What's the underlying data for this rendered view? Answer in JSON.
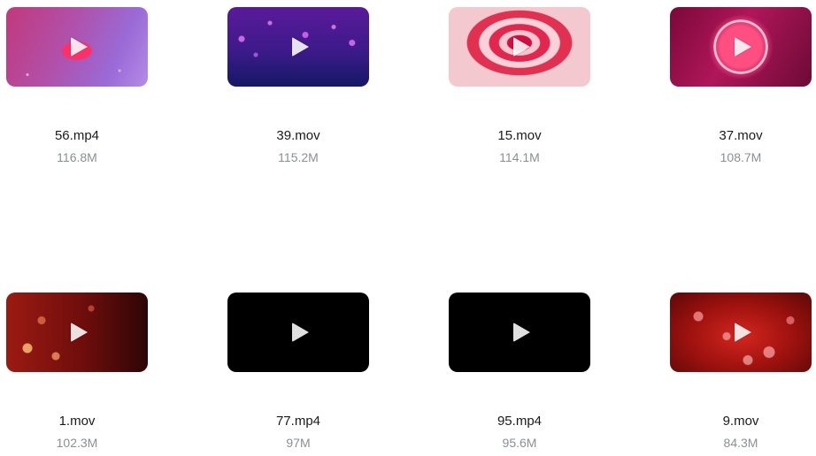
{
  "files": [
    {
      "name": "56.mp4",
      "size": "116.8M",
      "thumb_icon": "play-icon",
      "thumb_style": "heart-violet"
    },
    {
      "name": "39.mov",
      "size": "115.2M",
      "thumb_icon": "play-icon",
      "thumb_style": "bokeh-purple"
    },
    {
      "name": "15.mov",
      "size": "114.1M",
      "thumb_icon": "play-icon",
      "thumb_style": "heart-rings"
    },
    {
      "name": "37.mov",
      "size": "108.7M",
      "thumb_icon": "play-icon",
      "thumb_style": "heart-bubble"
    },
    {
      "name": "1.mov",
      "size": "102.3M",
      "thumb_icon": "play-icon",
      "thumb_style": "hearts-red"
    },
    {
      "name": "77.mp4",
      "size": "97M",
      "thumb_icon": "play-icon",
      "thumb_style": "black"
    },
    {
      "name": "95.mp4",
      "size": "95.6M",
      "thumb_icon": "play-icon",
      "thumb_style": "black"
    },
    {
      "name": "9.mov",
      "size": "84.3M",
      "thumb_icon": "play-icon",
      "thumb_style": "hearts-crimson"
    }
  ],
  "colors": {
    "filename": "#1a1a1a",
    "filesize": "#8a8f98",
    "background": "#ffffff"
  }
}
